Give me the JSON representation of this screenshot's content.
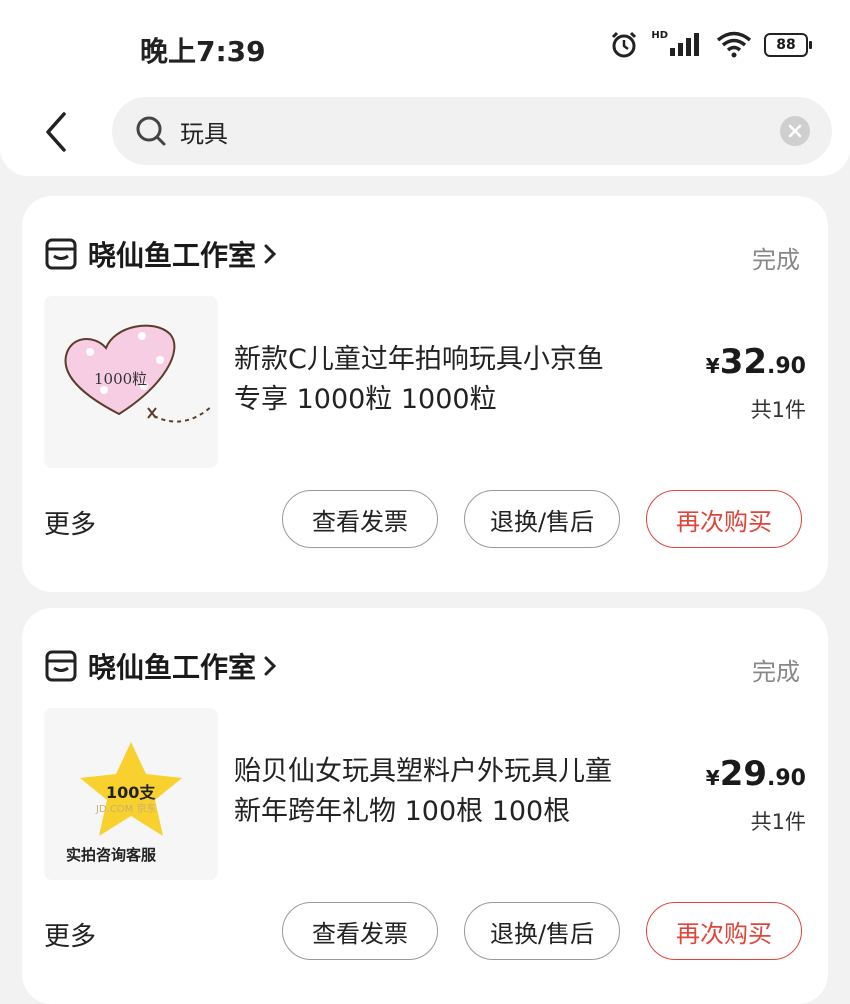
{
  "status_bar": {
    "time": "晚上7:39",
    "network": "HD",
    "battery": "88"
  },
  "search": {
    "query": "玩具"
  },
  "orders": [
    {
      "shop": "晓仙鱼工作室",
      "status": "完成",
      "thumb_text": "1000粒",
      "title": "新款C儿童过年拍响玩具小京鱼\n专享 1000粒 1000粒",
      "price_symbol": "¥",
      "price_int": "32",
      "price_dec": ".90",
      "qty": "共1件",
      "more": "更多",
      "btn_invoice": "查看发票",
      "btn_return": "退换/售后",
      "btn_rebuy": "再次购买"
    },
    {
      "shop": "晓仙鱼工作室",
      "status": "完成",
      "thumb_text": "100支",
      "thumb_watermark": "JD.COM 京东",
      "thumb_caption": "实拍咨询客服",
      "title": "贻贝仙女玩具塑料户外玩具儿童\n新年跨年礼物 100根 100根",
      "price_symbol": "¥",
      "price_int": "29",
      "price_dec": ".90",
      "qty": "共1件",
      "more": "更多",
      "btn_invoice": "查看发票",
      "btn_return": "退换/售后",
      "btn_rebuy": "再次购买"
    }
  ],
  "colors": {
    "accent": "#e0453a",
    "background": "#f2f2f2",
    "status_text": "#888888"
  }
}
